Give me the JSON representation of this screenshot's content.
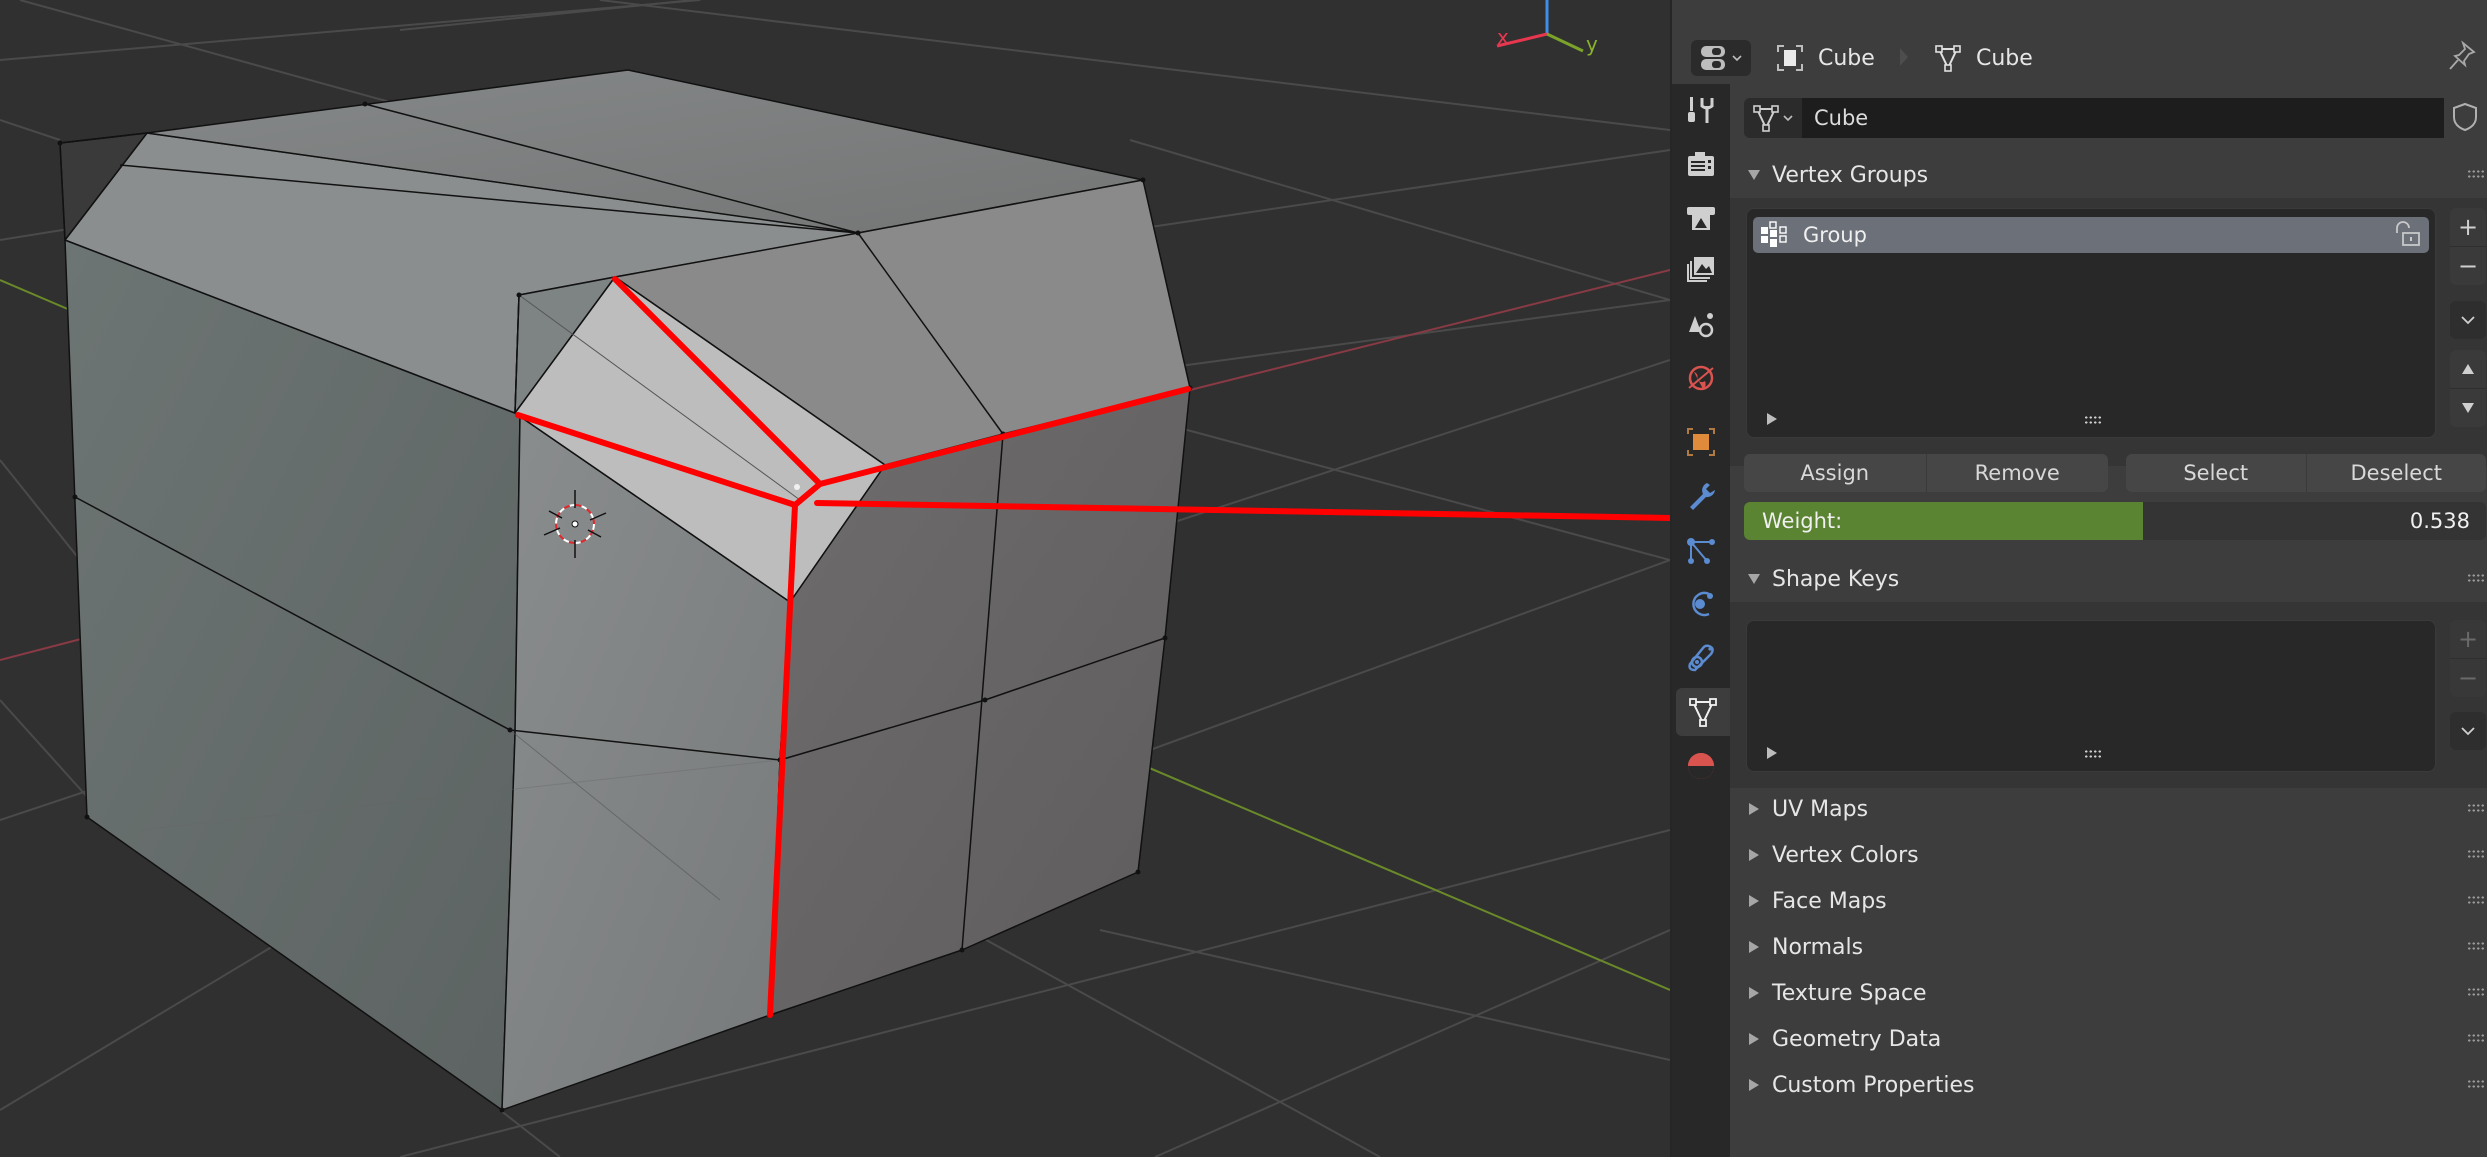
{
  "viewport": {
    "gizmo": {
      "x_label": "x",
      "y_label": "y"
    },
    "annotation_color": "#ff0000"
  },
  "properties": {
    "breadcrumb": [
      {
        "icon": "object-icon",
        "label": "Cube"
      },
      {
        "icon": "mesh-data-icon",
        "label": "Cube"
      }
    ],
    "tabs": [
      {
        "name": "tool",
        "icon": "tool-icon"
      },
      {
        "name": "render",
        "icon": "render-icon"
      },
      {
        "name": "output",
        "icon": "output-icon"
      },
      {
        "name": "view-layer",
        "icon": "view-layer-icon"
      },
      {
        "name": "scene",
        "icon": "scene-icon"
      },
      {
        "name": "world",
        "icon": "world-icon"
      },
      {
        "name": "object",
        "icon": "object-icon"
      },
      {
        "name": "modifiers",
        "icon": "wrench-icon"
      },
      {
        "name": "particles",
        "icon": "particles-icon"
      },
      {
        "name": "physics",
        "icon": "physics-icon"
      },
      {
        "name": "constraints",
        "icon": "constraint-icon"
      },
      {
        "name": "data",
        "icon": "mesh-data-icon",
        "active": true
      },
      {
        "name": "material",
        "icon": "material-icon"
      }
    ],
    "datablock": {
      "name": "Cube"
    },
    "vertex_groups": {
      "title": "Vertex Groups",
      "items": [
        {
          "name": "Group",
          "locked": false
        }
      ],
      "buttons": {
        "assign": "Assign",
        "remove": "Remove",
        "select": "Select",
        "deselect": "Deselect"
      },
      "weight": {
        "label": "Weight:",
        "value": "0.538",
        "fraction": 0.538
      }
    },
    "shape_keys": {
      "title": "Shape Keys",
      "items": []
    },
    "collapsed_panels": [
      {
        "title": "UV Maps"
      },
      {
        "title": "Vertex Colors"
      },
      {
        "title": "Face Maps"
      },
      {
        "title": "Normals"
      },
      {
        "title": "Texture Space"
      },
      {
        "title": "Geometry Data"
      },
      {
        "title": "Custom Properties"
      }
    ],
    "colors": {
      "weight_fill": "#5a8332",
      "list_highlight": "#6b7079",
      "object_tab": "#e08a3c",
      "blue_tabs": "#5b8bd0",
      "red_tabs": "#d9534f"
    }
  }
}
